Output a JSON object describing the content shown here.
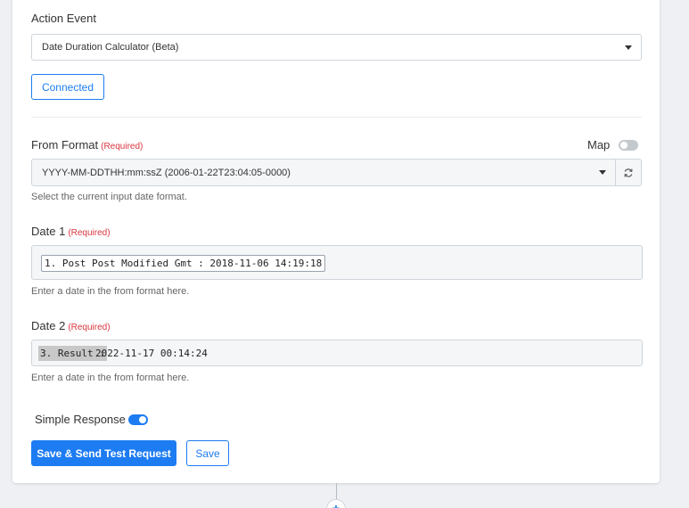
{
  "action_event": {
    "label": "Action Event",
    "selected": "Date Duration Calculator (Beta)",
    "connected_label": "Connected"
  },
  "from_format": {
    "label": "From Format",
    "required": "(Required)",
    "map_label": "Map",
    "map_enabled": false,
    "value": "YYYY-MM-DDTHH:mm:ssZ (2006-01-22T23:04:05-0000)",
    "helper": "Select the current input date format."
  },
  "date1": {
    "label": "Date 1",
    "required": "(Required)",
    "token": "1. Post Post Modified Gmt : 2018-11-06 14:19:18",
    "helper": "Enter a date in the from format here."
  },
  "date2": {
    "label": "Date 2",
    "required": "(Required)",
    "token_label": "3. Result :",
    "token_value": "2022-11-17 00:14:24",
    "helper": "Enter a date in the from format here."
  },
  "simple_response": {
    "label": "Simple Response",
    "enabled": true
  },
  "buttons": {
    "save_send": "Save & Send Test Request",
    "save": "Save"
  },
  "colors": {
    "accent": "#1d7cf2",
    "required": "#d9363e",
    "toggle_off": "#c4c9ce"
  },
  "icons": {
    "refresh": "refresh-icon",
    "dropdown": "chevron-down-icon",
    "add": "plus-icon"
  }
}
